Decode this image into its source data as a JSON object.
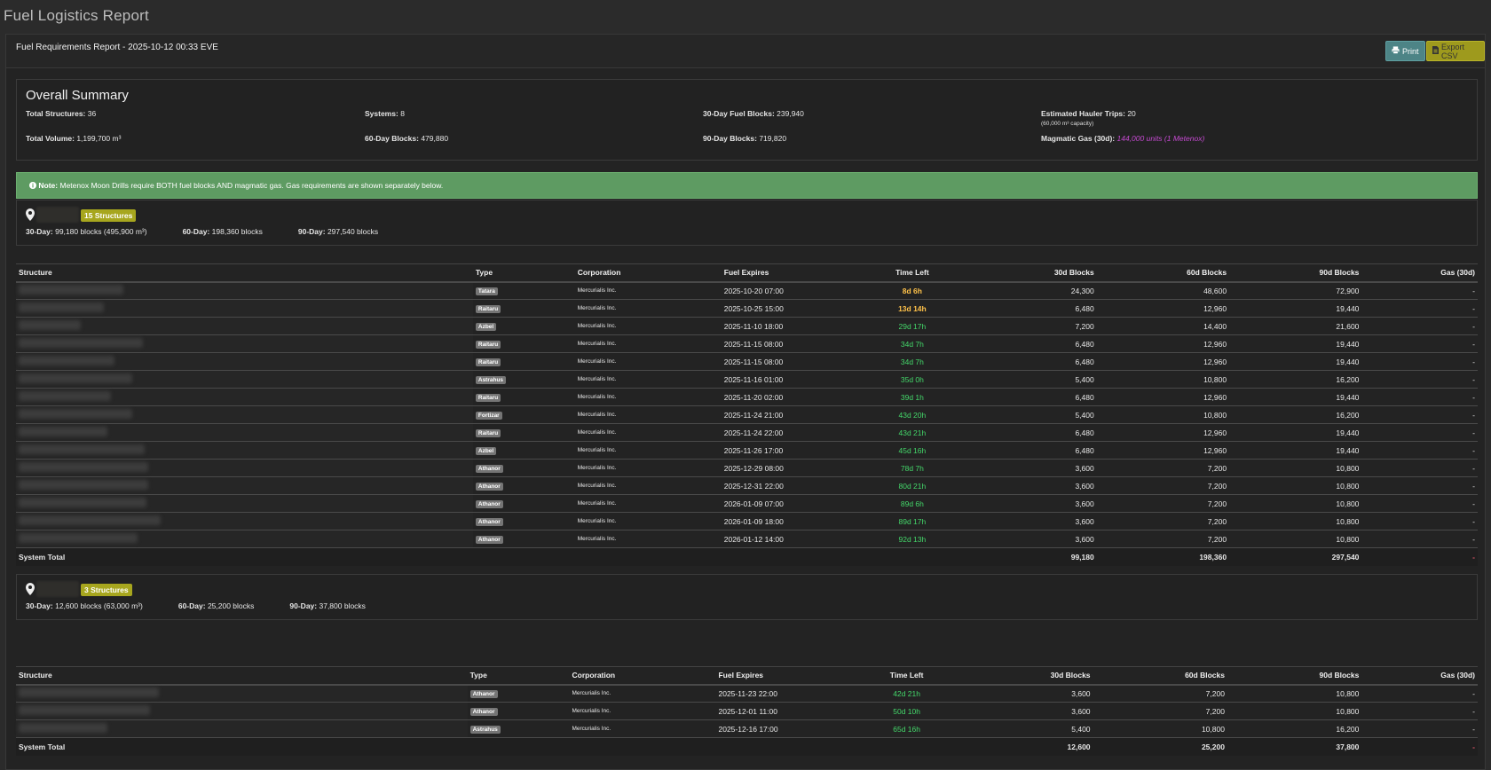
{
  "app_title": "Fuel Logistics Report",
  "report": {
    "title": "Fuel Requirements Report - 2025-10-12 00:33 EVE",
    "print_label": "Print",
    "export_label": "Export CSV"
  },
  "summary": {
    "heading": "Overall Summary",
    "total_structures_label": "Total Structures:",
    "total_structures": "36",
    "systems_label": "Systems:",
    "systems": "8",
    "fuel30_label": "30-Day Fuel Blocks:",
    "fuel30": "239,940",
    "hauler_label": "Estimated Hauler Trips:",
    "hauler": "20",
    "hauler_sub": "(60,000 m³ capacity)",
    "volume_label": "Total Volume:",
    "volume": "1,199,700 m³",
    "fuel60_label": "60-Day Blocks:",
    "fuel60": "479,880",
    "fuel90_label": "90-Day Blocks:",
    "fuel90": "719,820",
    "gas_label": "Magmatic Gas (30d):",
    "gas": "144,000 units (1 Metenox)"
  },
  "note": {
    "label": "Note:",
    "text": "Metenox Moon Drills require BOTH fuel blocks AND magmatic gas. Gas requirements are shown separately below."
  },
  "columns": [
    "Structure",
    "Type",
    "Corporation",
    "Fuel Expires",
    "Time Left",
    "30d Blocks",
    "60d Blocks",
    "90d Blocks",
    "Gas (30d)"
  ],
  "systems": [
    {
      "count_badge": "15 Structures",
      "stats": {
        "d30_label": "30-Day:",
        "d30": "99,180 blocks (495,900 m³)",
        "d60_label": "60-Day:",
        "d60": "198,360 blocks",
        "d90_label": "90-Day:",
        "d90": "297,540 blocks"
      },
      "rows": [
        {
          "type": "Tatara",
          "corp": "Mercurialis Inc.",
          "expires": "2025-10-20 07:00",
          "left": "8d 6h",
          "status": "warn",
          "b30": "24,300",
          "b60": "48,600",
          "b90": "72,900",
          "gas": "-"
        },
        {
          "type": "Raitaru",
          "corp": "Mercurialis Inc.",
          "expires": "2025-10-25 15:00",
          "left": "13d 14h",
          "status": "warn",
          "b30": "6,480",
          "b60": "12,960",
          "b90": "19,440",
          "gas": "-"
        },
        {
          "type": "Azbel",
          "corp": "Mercurialis Inc.",
          "expires": "2025-11-10 18:00",
          "left": "29d 17h",
          "status": "ok",
          "b30": "7,200",
          "b60": "14,400",
          "b90": "21,600",
          "gas": "-"
        },
        {
          "type": "Raitaru",
          "corp": "Mercurialis Inc.",
          "expires": "2025-11-15 08:00",
          "left": "34d 7h",
          "status": "ok",
          "b30": "6,480",
          "b60": "12,960",
          "b90": "19,440",
          "gas": "-"
        },
        {
          "type": "Raitaru",
          "corp": "Mercurialis Inc.",
          "expires": "2025-11-15 08:00",
          "left": "34d 7h",
          "status": "ok",
          "b30": "6,480",
          "b60": "12,960",
          "b90": "19,440",
          "gas": "-"
        },
        {
          "type": "Astrahus",
          "corp": "Mercurialis Inc.",
          "expires": "2025-11-16 01:00",
          "left": "35d 0h",
          "status": "ok",
          "b30": "5,400",
          "b60": "10,800",
          "b90": "16,200",
          "gas": "-"
        },
        {
          "type": "Raitaru",
          "corp": "Mercurialis Inc.",
          "expires": "2025-11-20 02:00",
          "left": "39d 1h",
          "status": "ok",
          "b30": "6,480",
          "b60": "12,960",
          "b90": "19,440",
          "gas": "-"
        },
        {
          "type": "Fortizar",
          "corp": "Mercurialis Inc.",
          "expires": "2025-11-24 21:00",
          "left": "43d 20h",
          "status": "ok",
          "b30": "5,400",
          "b60": "10,800",
          "b90": "16,200",
          "gas": "-"
        },
        {
          "type": "Raitaru",
          "corp": "Mercurialis Inc.",
          "expires": "2025-11-24 22:00",
          "left": "43d 21h",
          "status": "ok",
          "b30": "6,480",
          "b60": "12,960",
          "b90": "19,440",
          "gas": "-"
        },
        {
          "type": "Azbel",
          "corp": "Mercurialis Inc.",
          "expires": "2025-11-26 17:00",
          "left": "45d 16h",
          "status": "ok",
          "b30": "6,480",
          "b60": "12,960",
          "b90": "19,440",
          "gas": "-"
        },
        {
          "type": "Athanor",
          "corp": "Mercurialis Inc.",
          "expires": "2025-12-29 08:00",
          "left": "78d 7h",
          "status": "ok",
          "b30": "3,600",
          "b60": "7,200",
          "b90": "10,800",
          "gas": "-"
        },
        {
          "type": "Athanor",
          "corp": "Mercurialis Inc.",
          "expires": "2025-12-31 22:00",
          "left": "80d 21h",
          "status": "ok",
          "b30": "3,600",
          "b60": "7,200",
          "b90": "10,800",
          "gas": "-"
        },
        {
          "type": "Athanor",
          "corp": "Mercurialis Inc.",
          "expires": "2026-01-09 07:00",
          "left": "89d 6h",
          "status": "ok",
          "b30": "3,600",
          "b60": "7,200",
          "b90": "10,800",
          "gas": "-"
        },
        {
          "type": "Athanor",
          "corp": "Mercurialis Inc.",
          "expires": "2026-01-09 18:00",
          "left": "89d 17h",
          "status": "ok",
          "b30": "3,600",
          "b60": "7,200",
          "b90": "10,800",
          "gas": "-"
        },
        {
          "type": "Athanor",
          "corp": "Mercurialis Inc.",
          "expires": "2026-01-12 14:00",
          "left": "92d 13h",
          "status": "ok",
          "b30": "3,600",
          "b60": "7,200",
          "b90": "10,800",
          "gas": "-"
        }
      ],
      "total": {
        "label": "System Total",
        "b30": "99,180",
        "b60": "198,360",
        "b90": "297,540",
        "gas": "-"
      }
    },
    {
      "count_badge": "3 Structures",
      "stats": {
        "d30_label": "30-Day:",
        "d30": "12,600 blocks (63,000 m³)",
        "d60_label": "60-Day:",
        "d60": "25,200 blocks",
        "d90_label": "90-Day:",
        "d90": "37,800 blocks"
      },
      "rows": [
        {
          "type": "Athanor",
          "corp": "Mercurialis Inc.",
          "expires": "2025-11-23 22:00",
          "left": "42d 21h",
          "status": "ok",
          "b30": "3,600",
          "b60": "7,200",
          "b90": "10,800",
          "gas": "-"
        },
        {
          "type": "Athanor",
          "corp": "Mercurialis Inc.",
          "expires": "2025-12-01 11:00",
          "left": "50d 10h",
          "status": "ok",
          "b30": "3,600",
          "b60": "7,200",
          "b90": "10,800",
          "gas": "-"
        },
        {
          "type": "Astrahus",
          "corp": "Mercurialis Inc.",
          "expires": "2025-12-16 17:00",
          "left": "65d 16h",
          "status": "ok",
          "b30": "5,400",
          "b60": "10,800",
          "b90": "16,200",
          "gas": "-"
        }
      ],
      "total": {
        "label": "System Total",
        "b30": "12,600",
        "b60": "25,200",
        "b90": "37,800",
        "gas": "-"
      }
    }
  ]
}
